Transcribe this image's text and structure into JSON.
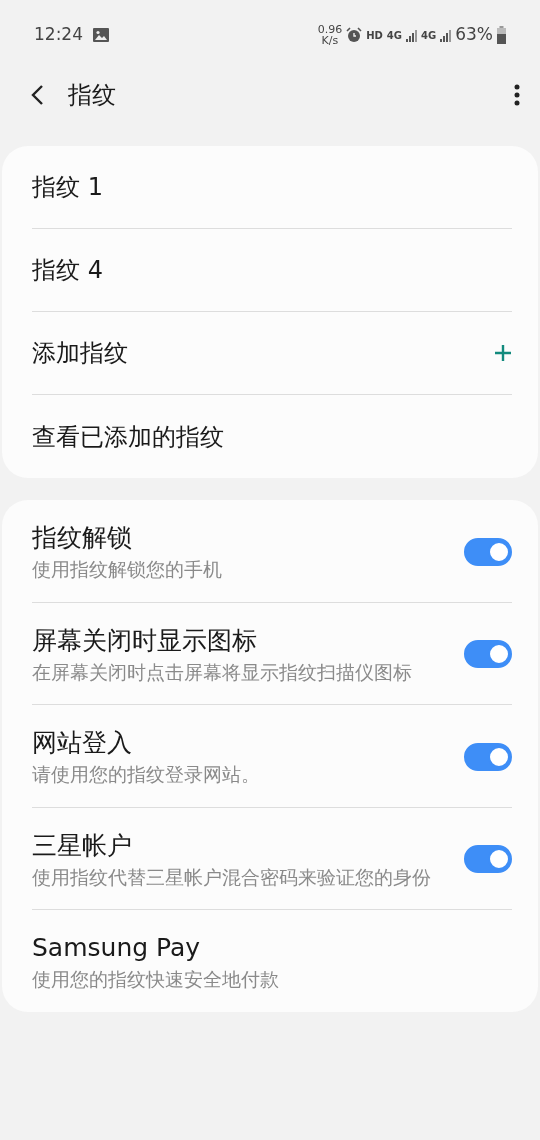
{
  "status_bar": {
    "time": "12:24",
    "speed_value": "0.96",
    "speed_unit": "K/s",
    "hd": "HD",
    "network_1": "4G",
    "network_2": "4G",
    "battery": "63%"
  },
  "header": {
    "title": "指纹"
  },
  "fingerprints": [
    {
      "kind": "item",
      "label": "指纹 1"
    },
    {
      "kind": "item",
      "label": "指纹 4"
    },
    {
      "kind": "add",
      "label": "添加指纹"
    },
    {
      "kind": "item",
      "label": "查看已添加的指纹"
    }
  ],
  "settings": [
    {
      "title": "指纹解锁",
      "subtitle": "使用指纹解锁您的手机",
      "kind": "switch",
      "on": true
    },
    {
      "title": "屏幕关闭时显示图标",
      "subtitle": "在屏幕关闭时点击屏幕将显示指纹扫描仪图标",
      "kind": "switch",
      "on": true
    },
    {
      "title": "网站登入",
      "subtitle": "请使用您的指纹登录网站。",
      "kind": "switch",
      "on": true
    },
    {
      "title": "三星帐户",
      "subtitle": "使用指纹代替三星帐户混合密码来验证您的身份",
      "kind": "switch",
      "on": true
    },
    {
      "title": "Samsung Pay",
      "subtitle": "使用您的指纹快速安全地付款",
      "kind": "plain"
    }
  ]
}
